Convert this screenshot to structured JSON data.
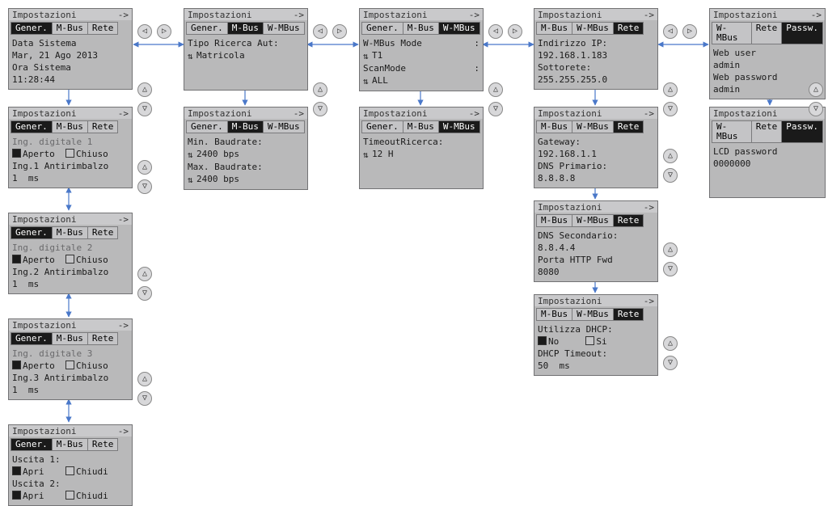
{
  "title": "Impostazioni",
  "title_arrow": "->",
  "tabs": {
    "gener": "Gener.",
    "mbus": "M-Bus",
    "wmbus": "W-MBus",
    "rete": "Rete",
    "passw": "Passw."
  },
  "col1": {
    "p1": {
      "l1": "Data Sistema",
      "v1": "Mar, 21 Ago 2013",
      "l2": "Ora Sistema",
      "v2": "11:28:44"
    },
    "p2": {
      "h": "Ing. digitale 1",
      "a": "Aperto",
      "c": "Chiuso",
      "l": "Ing.1 Antirimbalzo",
      "v": "1  ms"
    },
    "p3": {
      "h": "Ing. digitale 2",
      "a": "Aperto",
      "c": "Chiuso",
      "l": "Ing.2 Antirimbalzo",
      "v": "1  ms"
    },
    "p4": {
      "h": "Ing. digitale 3",
      "a": "Aperto",
      "c": "Chiuso",
      "l": "Ing.3 Antirimbalzo",
      "v": "1  ms"
    },
    "p5": {
      "u1": "Uscita 1:",
      "u2": "Uscita 2:",
      "a": "Apri",
      "c": "Chiudi"
    }
  },
  "col2": {
    "p1": {
      "l": "Tipo Ricerca Aut:",
      "v": "Matricola"
    },
    "p2": {
      "l1": "Min. Baudrate:",
      "v1": "2400 bps",
      "l2": "Max. Baudrate:",
      "v2": "2400 bps"
    }
  },
  "col3": {
    "p1": {
      "l1": "W-MBus Mode",
      "v1": "T1",
      "l2": "ScanMode",
      "v2": "ALL"
    },
    "p2": {
      "l": "TimeoutRicerca:",
      "v": "12 H"
    }
  },
  "col4": {
    "p1": {
      "l1": "Indirizzo IP:",
      "v1": "192.168.1.183",
      "l2": "Sottorete:",
      "v2": "255.255.255.0"
    },
    "p2": {
      "l1": "Gateway:",
      "v1": "192.168.1.1",
      "l2": "DNS Primario:",
      "v2": "8.8.8.8"
    },
    "p3": {
      "l1": "DNS Secondario:",
      "v1": "8.8.4.4",
      "l2": "Porta HTTP Fwd",
      "v2": "8080"
    },
    "p4": {
      "l": "Utilizza DHCP:",
      "no": "No",
      "si": "Si",
      "l2": "DHCP Timeout:",
      "v2": "50  ms"
    }
  },
  "col5": {
    "p1": {
      "l1": "Web user",
      "v1": "admin",
      "l2": "Web password",
      "v2": "admin"
    },
    "p2": {
      "l": "LCD password",
      "v": "0000000"
    }
  },
  "nav": {
    "left": "◁",
    "right": "▷",
    "up": "△",
    "down": "▽"
  }
}
